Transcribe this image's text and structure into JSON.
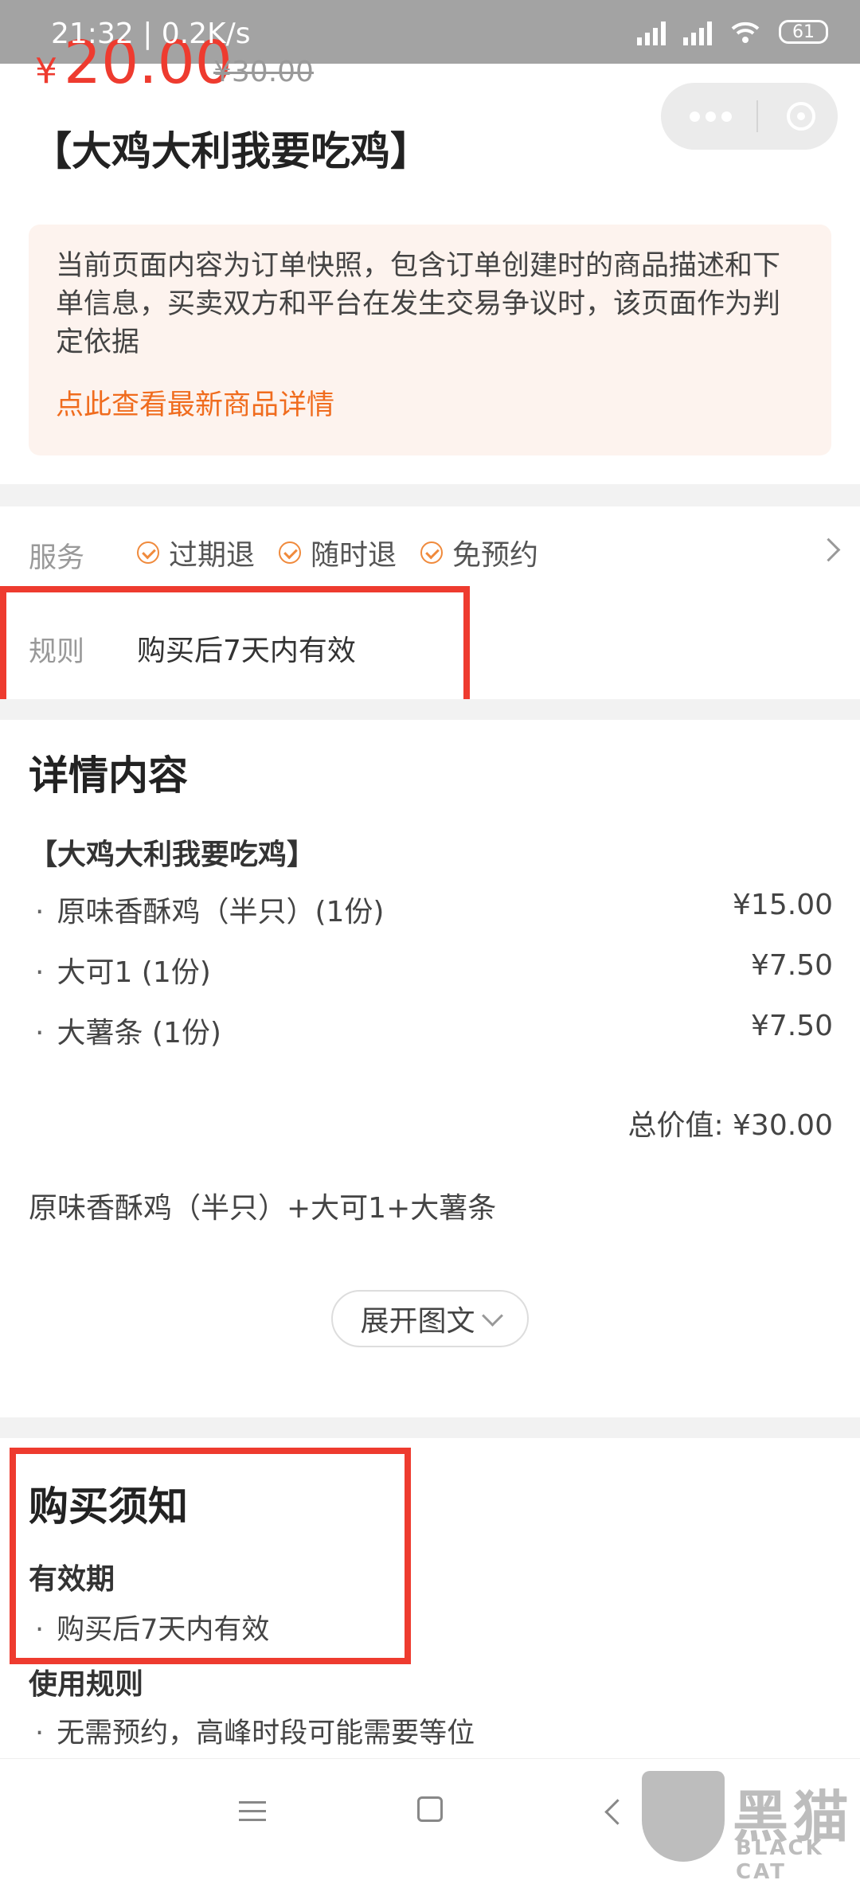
{
  "status_bar": {
    "time_speed": "21:32 | 0.2K/s",
    "battery": "61"
  },
  "price": {
    "currency": "¥",
    "current": "20.00",
    "original": "¥30.00"
  },
  "title": "【大鸡大利我要吃鸡】",
  "notice": {
    "text": "当前页面内容为订单快照，包含订单创建时的商品描述和下单信息，买卖双方和平台在发生交易争议时，该页面作为判定依据",
    "link": "点此查看最新商品详情"
  },
  "service": {
    "label": "服务",
    "items": [
      "过期退",
      "随时退",
      "免预约"
    ]
  },
  "rule": {
    "label": "规则",
    "value": "购买后7天内有效"
  },
  "details": {
    "heading": "详情内容",
    "package_name": "【大鸡大利我要吃鸡】",
    "items": [
      {
        "name": "原味香酥鸡（半只）(1份)",
        "price": "¥15.00"
      },
      {
        "name": "大可1 (1份)",
        "price": "¥7.50"
      },
      {
        "name": "大薯条 (1份)",
        "price": "¥7.50"
      }
    ],
    "total": "总价值: ¥30.00",
    "summary": "原味香酥鸡（半只）+大可1+大薯条",
    "expand_label": "展开图文"
  },
  "purchase_notes": {
    "heading": "购买须知",
    "validity_title": "有效期",
    "validity_text": "购买后7天内有效",
    "usage_title": "使用规则",
    "usage_text": "无需预约，高峰时段可能需要等位"
  },
  "watermark": {
    "cn": "黑猫",
    "en": "BLACK CAT"
  },
  "colors": {
    "accent": "#ee3b2f",
    "link": "#f06c1e",
    "highlight_box": "#ee3b2f"
  }
}
